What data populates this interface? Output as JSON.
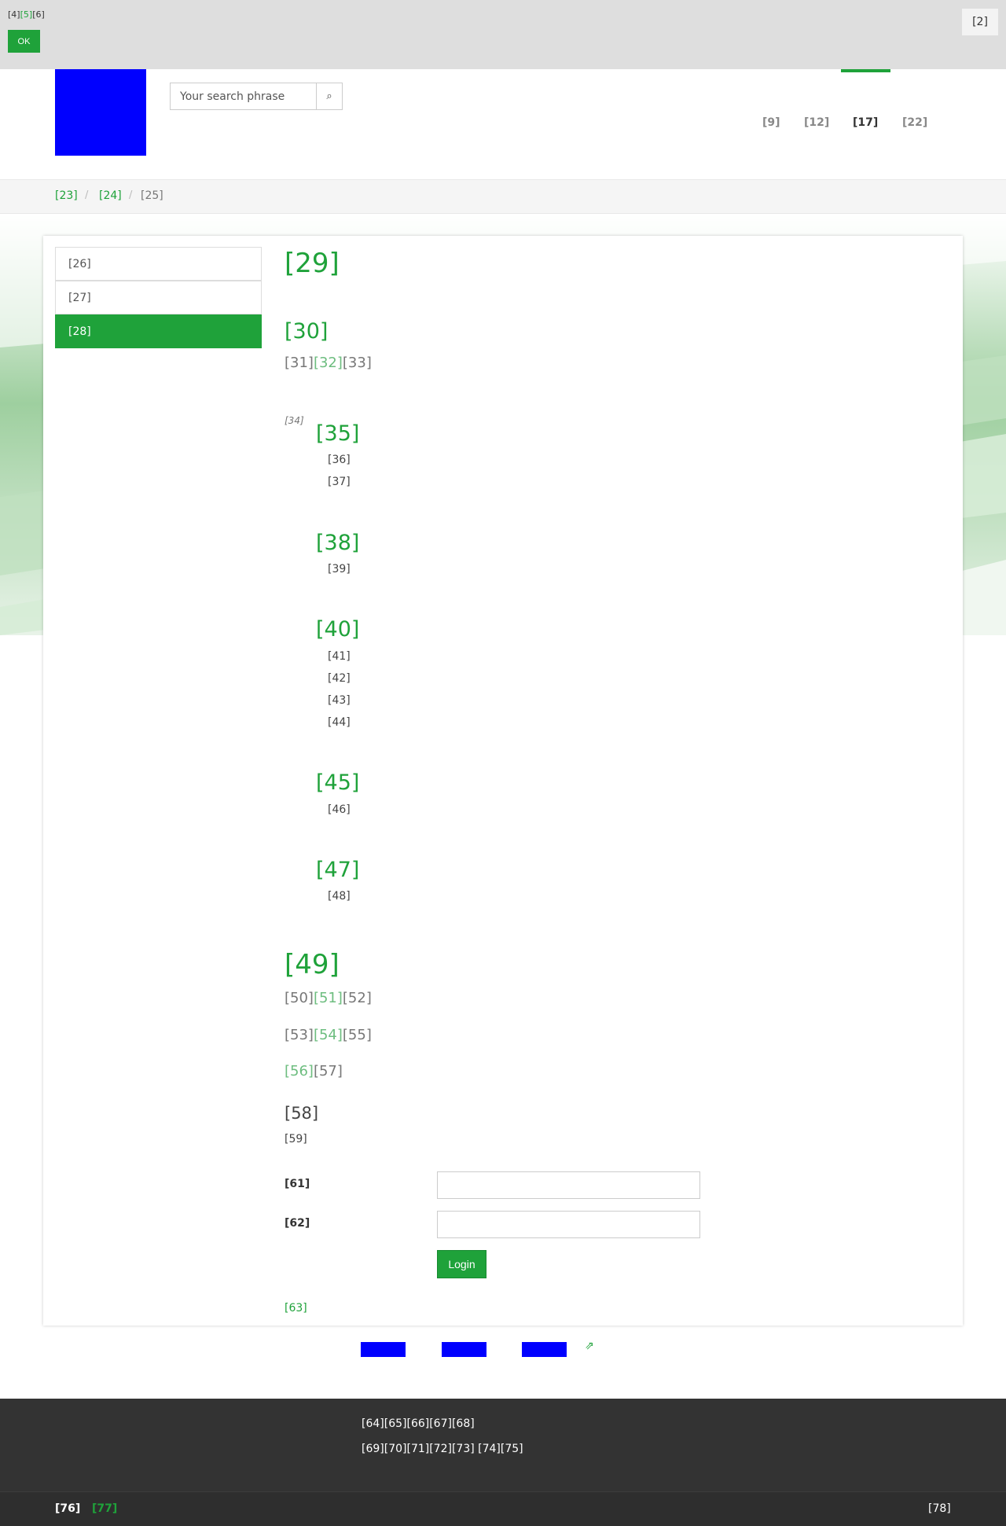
{
  "cookie_bar": {
    "text_a": "[4]",
    "text_link": "[5]",
    "text_b": "[6]",
    "ok_label": "OK",
    "close_label": "[2]"
  },
  "search": {
    "placeholder": "Your search phrase",
    "button_icon": "⌕"
  },
  "nav": {
    "items": [
      "[9]",
      "[12]",
      "[17]",
      "[22]"
    ],
    "active_index": 2
  },
  "breadcrumb": {
    "items": [
      "[23]",
      "[24]",
      "[25]"
    ],
    "separator": "/"
  },
  "sidebar": {
    "items": [
      "[26]",
      "[27]",
      "[28]"
    ],
    "active_index": 2
  },
  "main": {
    "page_title": "[29]",
    "section1": {
      "title": "[30]",
      "line": [
        "[31]",
        "[32]",
        "[33]"
      ]
    },
    "caption": "[34]",
    "groups": [
      {
        "title": "[35]",
        "items": [
          "[36]",
          "[37]"
        ]
      },
      {
        "title": "[38]",
        "items": [
          "[39]"
        ]
      },
      {
        "title": "[40]",
        "items": [
          "[41]",
          "[42]",
          "[43]",
          "[44]"
        ]
      },
      {
        "title": "[45]",
        "items": [
          "[46]"
        ]
      },
      {
        "title": "[47]",
        "items": [
          "[48]"
        ]
      }
    ],
    "section2": {
      "title": "[49]",
      "line1": [
        "[50]",
        "[51]",
        "[52]"
      ],
      "line2": [
        "[53]",
        "[54]",
        "[55]"
      ],
      "line3": [
        "[56]",
        "[57]"
      ]
    },
    "login": {
      "title": "[58]",
      "subtitle": "[59]",
      "field1_label": "[61]",
      "field2_label": "[62]",
      "button_label": "Login",
      "link": "[63]"
    }
  },
  "social": {
    "share_icon": "⇗"
  },
  "footer": {
    "row1": "[64][65][66][67][68]",
    "row2": "[69][70][71][72][73] [74][75]",
    "bottom_left": "[76]",
    "bottom_link": "[77]",
    "bottom_right": "[78]"
  },
  "colors": {
    "accent": "#1fa23a",
    "placeholder_blue": "#0000ff",
    "footer_bg": "#333333"
  }
}
